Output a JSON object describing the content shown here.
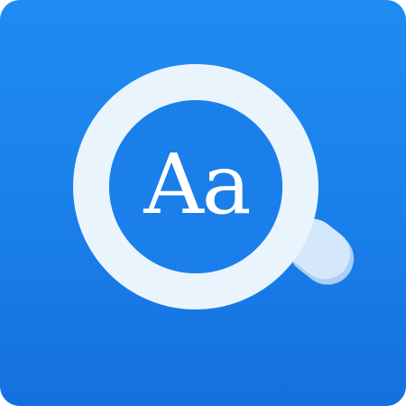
{
  "icon": {
    "name": "magnifier-dictionary-icon",
    "text": "Aa",
    "colors": {
      "background": "#1a7fea",
      "ring": "#eaf4fd",
      "handle": "#d5e8fb",
      "handle_shadow": "#a9cff4",
      "text": "#ffffff"
    }
  }
}
